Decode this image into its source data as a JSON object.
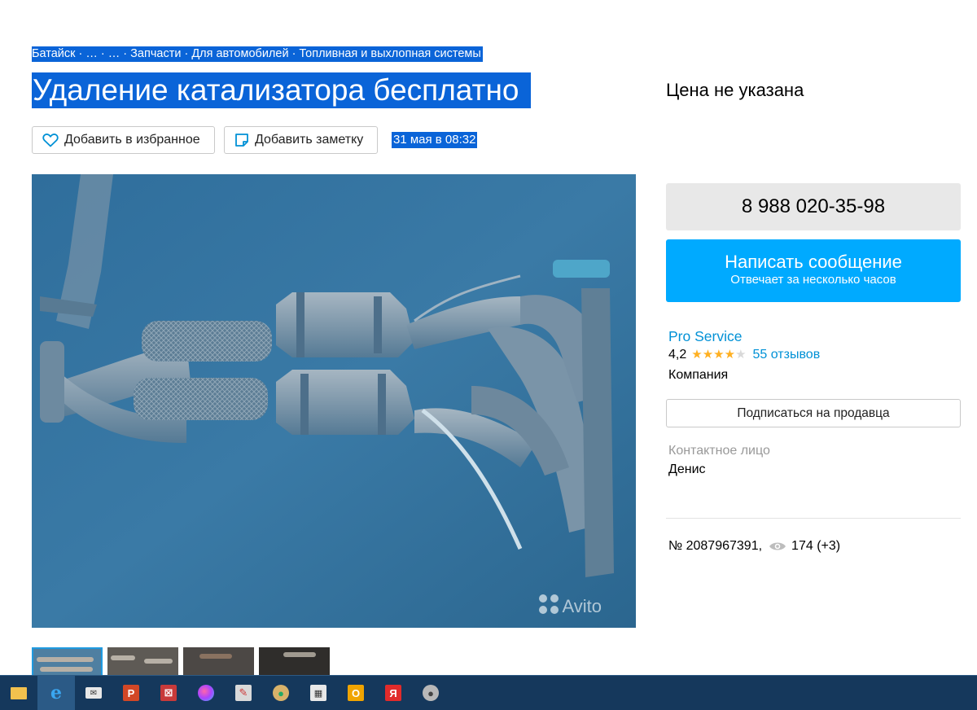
{
  "breadcrumb": "Батайск · … · … · Запчасти · Для автомобилей · Топливная и выхлопная системы",
  "title": "Удаление катализатора бесплатно",
  "price": "Цена не указана",
  "actions": {
    "favorite_label": "Добавить в избранное",
    "note_label": "Добавить заметку"
  },
  "date": "31 мая в 08:32",
  "photo": {
    "watermark": "Avito"
  },
  "contact": {
    "phone": "8 988 020-35-98",
    "write_label": "Написать сообщение",
    "write_sub": "Отвечает за несколько часов"
  },
  "seller": {
    "name": "Pro Service",
    "rating": "4,2",
    "stars_filled": 4,
    "stars_total": 5,
    "reviews": "55 отзывов",
    "type": "Компания",
    "subscribe_label": "Подписаться на продавца",
    "contact_label": "Контактное лицо",
    "contact_name": "Денис"
  },
  "item": {
    "number": "№ 2087967391,",
    "views": "174 (+3)"
  },
  "colors": {
    "selection": "#0a64d8",
    "accent": "#00aaff",
    "link": "#0091d6",
    "star": "#ffb021",
    "taskbar": "#15385c"
  },
  "taskbar": {
    "icons": [
      "file-explorer-icon",
      "internet-explorer-icon",
      "mail-icon",
      "powerpoint-icon",
      "chart-app-icon",
      "balloon-icon",
      "paint-icon",
      "palette-icon",
      "calculator-icon",
      "outlook-icon",
      "yandex-icon",
      "scanner-icon"
    ]
  }
}
